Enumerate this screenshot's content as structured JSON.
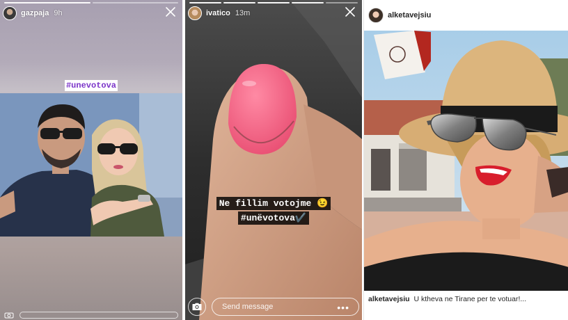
{
  "stories": [
    {
      "username": "gazpaja",
      "time": "9h",
      "hashtag": "#unevotova",
      "progress_segments": [
        1,
        0
      ],
      "icons": [
        "close-icon"
      ]
    },
    {
      "username": "ivatico",
      "time": "13m",
      "caption_line1": "Ne fillim votojme 😉",
      "caption_line2": "#unëvotova✔️",
      "message_placeholder": "Send message",
      "progress_segments": [
        1,
        1,
        1,
        1,
        0
      ],
      "icons": [
        "camera-icon",
        "more-icon",
        "close-icon"
      ]
    }
  ],
  "post": {
    "username": "alketavejsiu",
    "caption_user": "alketavejsiu",
    "caption_text": "U ktheva ne Tirane per te votuar!..."
  },
  "colors": {
    "hashtag_purple": "#7b34c9",
    "lipstick": "#d81e2c",
    "nail_pink": "#ef5a7c",
    "hat_straw": "#d9b27a"
  }
}
